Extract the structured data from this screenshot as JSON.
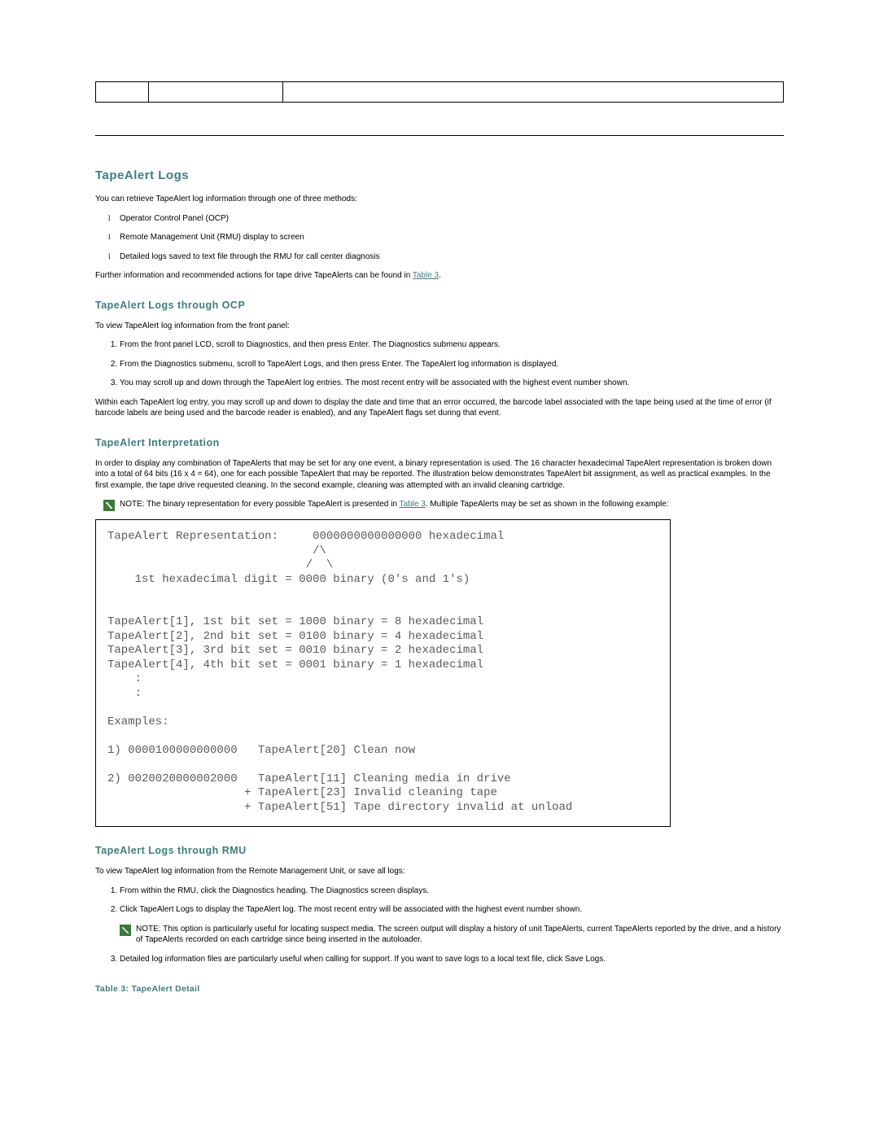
{
  "headings": {
    "h2": "TapeAlert Logs",
    "h3_ocp": "TapeAlert Logs through OCP",
    "h3_interp": "TapeAlert Interpretation",
    "h3_rmu": "TapeAlert Logs through RMU",
    "table_caption": "Table 3: TapeAlert Detail"
  },
  "intro": {
    "p1": "You can retrieve TapeAlert log information through one of three methods:",
    "bullets": [
      "Operator Control Panel (OCP)",
      "Remote Management Unit (RMU) display to screen",
      "Detailed logs saved to text file through the RMU for call center diagnosis"
    ],
    "p2a": "Further information and recommended actions for tape drive TapeAlerts can be found in ",
    "p2_link": "Table 3",
    "p2b": "."
  },
  "ocp": {
    "p1": "To view TapeAlert log information from the front panel:",
    "steps": [
      "From the front panel LCD, scroll to Diagnostics, and then press Enter. The Diagnostics submenu appears.",
      "From the Diagnostics submenu, scroll to TapeAlert Logs, and then press Enter. The TapeAlert log information is displayed.",
      "You may scroll up and down through the TapeAlert log entries. The most recent entry will be associated with the highest event number shown."
    ],
    "p2": "Within each TapeAlert log entry, you may scroll up and down to display the date and time that an error occurred, the barcode label associated with the tape being used at the time of error (if barcode labels are being used and the barcode reader is enabled), and any TapeAlert flags set during that event."
  },
  "interp": {
    "p1": "In order to display any combination of TapeAlerts that may be set for any one event, a binary representation is used. The 16 character hexadecimal TapeAlert representation is broken down into a total of 64 bits (16 x 4 = 64), one for each possible TapeAlert that may be reported. The illustration below demonstrates TapeAlert bit assignment, as well as practical examples. In the first example, the tape drive requested cleaning. In the second example, cleaning was attempted with an invalid cleaning cartridge.",
    "note_a": "NOTE: The binary representation for every possible TapeAlert is presented in ",
    "note_link": "Table 3",
    "note_b": ". Multiple TapeAlerts may be set as shown in the following example:",
    "diagram": "TapeAlert Representation:     0000000000000000 hexadecimal\n                              /\\\n                             /  \\\n    1st hexadecimal digit = 0000 binary (0's and 1's)\n\n\nTapeAlert[1], 1st bit set = 1000 binary = 8 hexadecimal\nTapeAlert[2], 2nd bit set = 0100 binary = 4 hexadecimal\nTapeAlert[3], 3rd bit set = 0010 binary = 2 hexadecimal\nTapeAlert[4], 4th bit set = 0001 binary = 1 hexadecimal\n    :\n    :\n\nExamples:\n\n1) 0000100000000000   TapeAlert[20] Clean now\n\n2) 0020020000002000   TapeAlert[11] Cleaning media in drive\n                    + TapeAlert[23] Invalid cleaning tape\n                    + TapeAlert[51] Tape directory invalid at unload"
  },
  "rmu": {
    "p1": "To view TapeAlert log information from the Remote Management Unit, or save all logs:",
    "step1": "From within the RMU, click the Diagnostics heading. The Diagnostics screen displays.",
    "step2": "Click TapeAlert Logs to display the TapeAlert log. The most recent entry will be associated with the highest event number shown.",
    "note": "NOTE: This option is particularly useful for locating suspect media. The screen output will display a history of unit TapeAlerts, current TapeAlerts reported by the drive, and a history of TapeAlerts recorded on each cartridge since being inserted in the autoloader.",
    "step3": "Detailed log information files are particularly useful when calling for support. If you want to save logs to a local text file, click Save Logs."
  }
}
